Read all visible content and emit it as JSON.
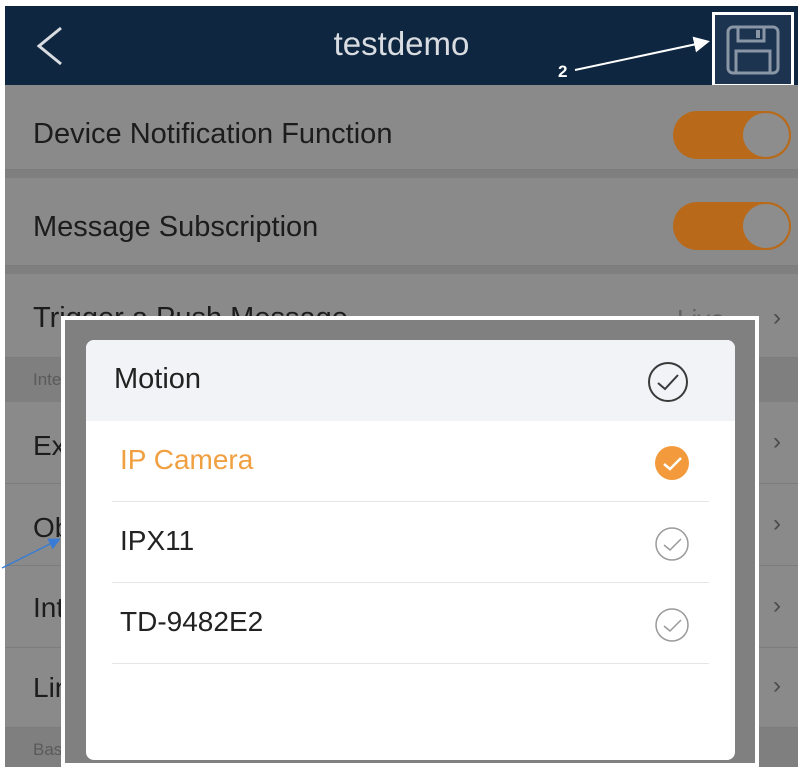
{
  "header": {
    "title": "testdemo",
    "annotation_number": "2"
  },
  "settings": {
    "device_notification": {
      "label": "Device Notification Function",
      "enabled": true
    },
    "message_subscription": {
      "label": "Message Subscription",
      "enabled": true
    },
    "trigger_push": {
      "label": "Trigger a Push Message",
      "value": "Live"
    },
    "section_intel": "Intel",
    "item_exc": "Ex",
    "item_obj": "Obj",
    "item_int": "Int",
    "item_lin": "Lin",
    "section_basic": "Basi"
  },
  "popup": {
    "title": "Motion",
    "options": [
      {
        "label": "IP Camera",
        "selected": true
      },
      {
        "label": "IPX11",
        "selected": false
      },
      {
        "label": "TD-9482E2",
        "selected": false
      }
    ]
  },
  "colors": {
    "header_bg": "#0e2640",
    "accent": "#f0a040",
    "toggle_on": "#b86a1a"
  },
  "icons": [
    "back-chevron-icon",
    "save-floppy-icon",
    "chevron-right-icon",
    "check-circle-icon"
  ]
}
